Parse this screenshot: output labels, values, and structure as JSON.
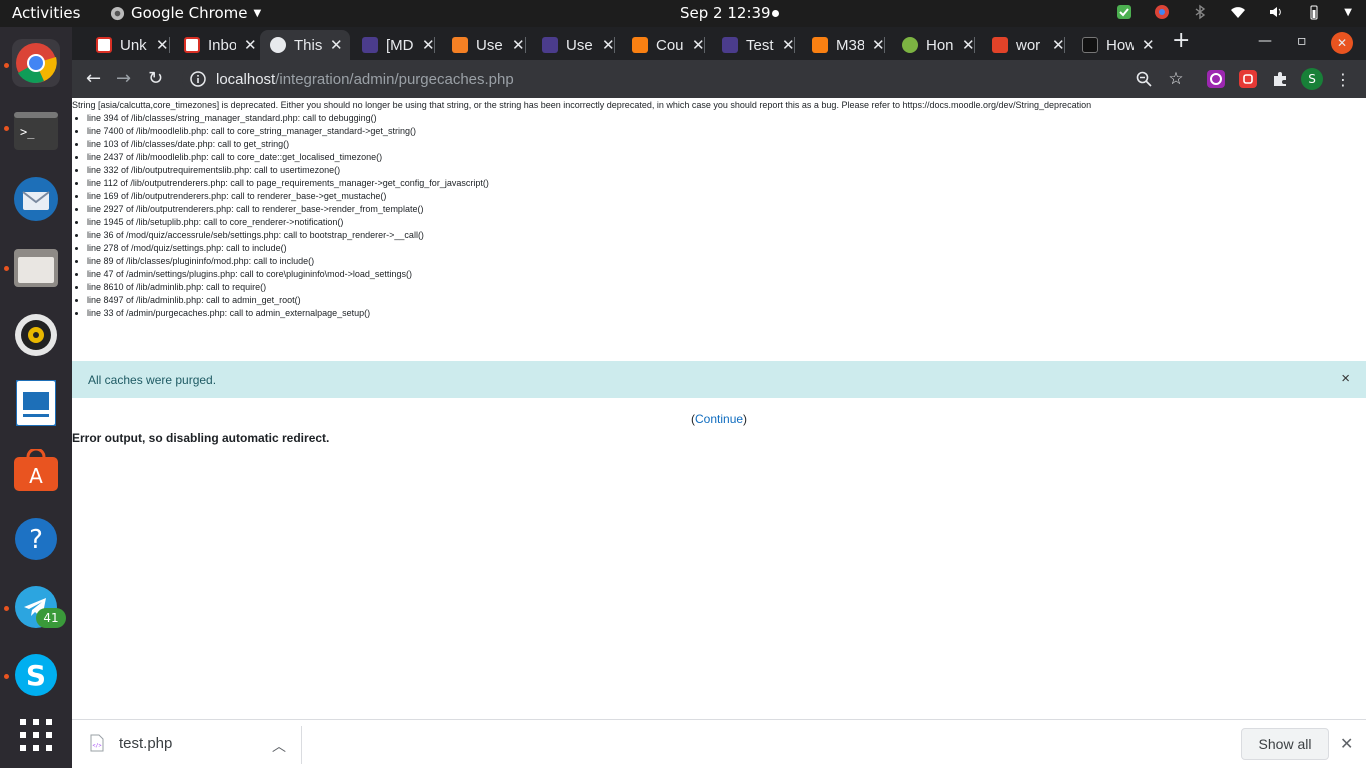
{
  "topbar": {
    "activities": "Activities",
    "app_name": "Google Chrome",
    "datetime": "Sep 2  12:39"
  },
  "dock": {
    "items": [
      "chrome",
      "terminal",
      "thunderbird",
      "files",
      "rhythmbox",
      "libreoffice-impress",
      "software",
      "help",
      "telegram",
      "skype",
      "apps-grid"
    ],
    "telegram_badge": "41"
  },
  "tabs": [
    {
      "title": "Unk",
      "icon": "gmail-icon"
    },
    {
      "title": "Inbo",
      "icon": "gmail-icon"
    },
    {
      "title": "This",
      "icon": "globe-icon",
      "active": true
    },
    {
      "title": "[MD",
      "icon": "moodle-icon"
    },
    {
      "title": "Use",
      "icon": "stackoverflow-icon"
    },
    {
      "title": "Use",
      "icon": "moodle-icon"
    },
    {
      "title": "Cou",
      "icon": "moodle-orange-icon"
    },
    {
      "title": "Test",
      "icon": "moodle-icon"
    },
    {
      "title": "M38",
      "icon": "moodle-orange-icon"
    },
    {
      "title": "Hon",
      "icon": "green-icon"
    },
    {
      "title": "wor",
      "icon": "gitlab-icon"
    },
    {
      "title": "How",
      "icon": "hat-icon"
    }
  ],
  "toolbar": {
    "url_host": "localhost",
    "url_path": "/integration/admin/purgecaches.php",
    "profile_initial": "S"
  },
  "page": {
    "debug_message": "String [asia/calcutta,core_timezones] is deprecated. Either you should no longer be using that string, or the string has been incorrectly deprecated, in which case you should report this as a bug. Please refer to https://docs.moodle.org/dev/String_deprecation",
    "trace": [
      "line 394 of /lib/classes/string_manager_standard.php: call to debugging()",
      "line 7400 of /lib/moodlelib.php: call to core_string_manager_standard->get_string()",
      "line 103 of /lib/classes/date.php: call to get_string()",
      "line 2437 of /lib/moodlelib.php: call to core_date::get_localised_timezone()",
      "line 332 of /lib/outputrequirementslib.php: call to usertimezone()",
      "line 112 of /lib/outputrenderers.php: call to page_requirements_manager->get_config_for_javascript()",
      "line 169 of /lib/outputrenderers.php: call to renderer_base->get_mustache()",
      "line 2927 of /lib/outputrenderers.php: call to renderer_base->render_from_template()",
      "line 1945 of /lib/setuplib.php: call to core_renderer->notification()",
      "line 36 of /mod/quiz/accessrule/seb/settings.php: call to bootstrap_renderer->__call()",
      "line 278 of /mod/quiz/settings.php: call to include()",
      "line 89 of /lib/classes/plugininfo/mod.php: call to include()",
      "line 47 of /admin/settings/plugins.php: call to core\\plugininfo\\mod->load_settings()",
      "line 8610 of /lib/adminlib.php: call to require()",
      "line 8497 of /lib/adminlib.php: call to admin_get_root()",
      "line 33 of /admin/purgecaches.php: call to admin_externalpage_setup()"
    ],
    "alert": "All caches were purged.",
    "alert_close": "×",
    "continue_open": "(",
    "continue_link": "Continue",
    "continue_close": ")",
    "error": "Error output, so disabling automatic redirect."
  },
  "downloads": {
    "file": "test.php",
    "show_all": "Show all"
  }
}
